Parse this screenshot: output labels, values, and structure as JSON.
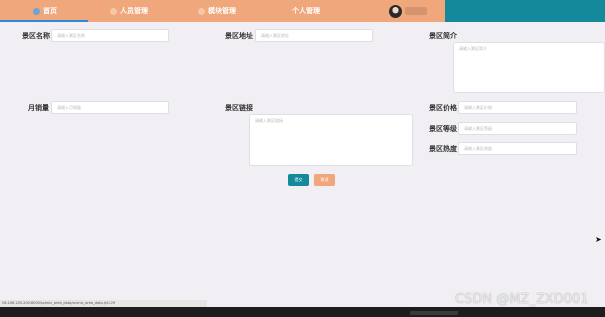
{
  "nav": {
    "items": [
      {
        "label": "首页",
        "icon": "home-icon"
      },
      {
        "label": "人员管理",
        "icon": "user-icon"
      },
      {
        "label": "模块管理",
        "icon": "module-icon"
      },
      {
        "label": "个人管理",
        "icon": "profile-icon"
      }
    ]
  },
  "form": {
    "name": {
      "label": "景区名称",
      "placeholder": "请输入景区名称"
    },
    "address": {
      "label": "景区地址",
      "placeholder": "请输入景区地址"
    },
    "intro": {
      "label": "景区简介",
      "placeholder": "请输入景区简介"
    },
    "monthly": {
      "label": "月销量",
      "placeholder": "请输入月销量"
    },
    "link": {
      "label": "景区链接",
      "placeholder": "请输入景区链接"
    },
    "price": {
      "label": "景区价格",
      "placeholder": "请输入景区价格"
    },
    "grade": {
      "label": "景区等级",
      "placeholder": "请输入景区等级"
    },
    "heat": {
      "label": "景区热度",
      "placeholder": "请输入景区热度"
    }
  },
  "buttons": {
    "submit": "提交",
    "cancel": "取消"
  },
  "status_url": "26.106.105.200:8000/scenic_area_data/scenic_area_data.jsf=29",
  "watermark": "CSDN @MZ_ZXD001",
  "colors": {
    "nav": "#f0a77c",
    "nav_right": "#14899c",
    "submit": "#14899c",
    "cancel": "#f0a77c",
    "active_underline": "#2f88d6"
  }
}
